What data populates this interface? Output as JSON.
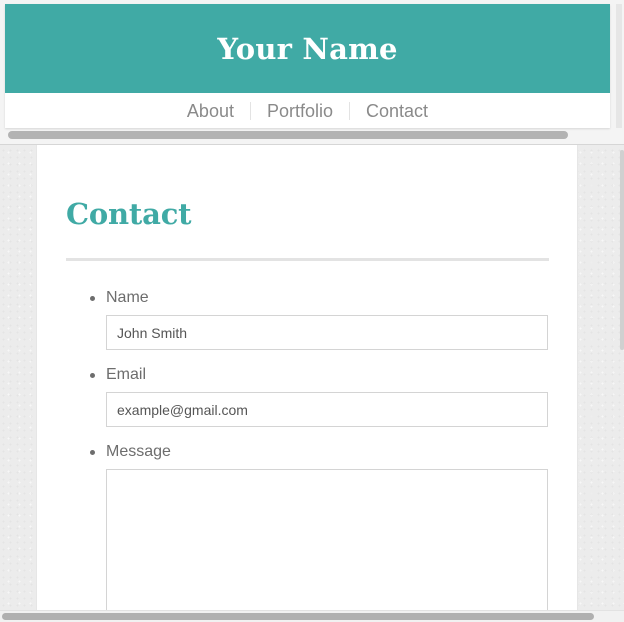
{
  "header": {
    "site_title": "Your Name",
    "nav": [
      "About",
      "Portfolio",
      "Contact"
    ]
  },
  "page": {
    "title": "Contact"
  },
  "form": {
    "name_label": "Name",
    "name_placeholder": "John Smith",
    "email_label": "Email",
    "email_placeholder": "example@gmail.com",
    "message_label": "Message",
    "message_value": ""
  },
  "colors": {
    "accent": "#40aaa5",
    "text": "#6d6d6d",
    "nav_text": "#8a8a8a",
    "background": "#ececec"
  }
}
